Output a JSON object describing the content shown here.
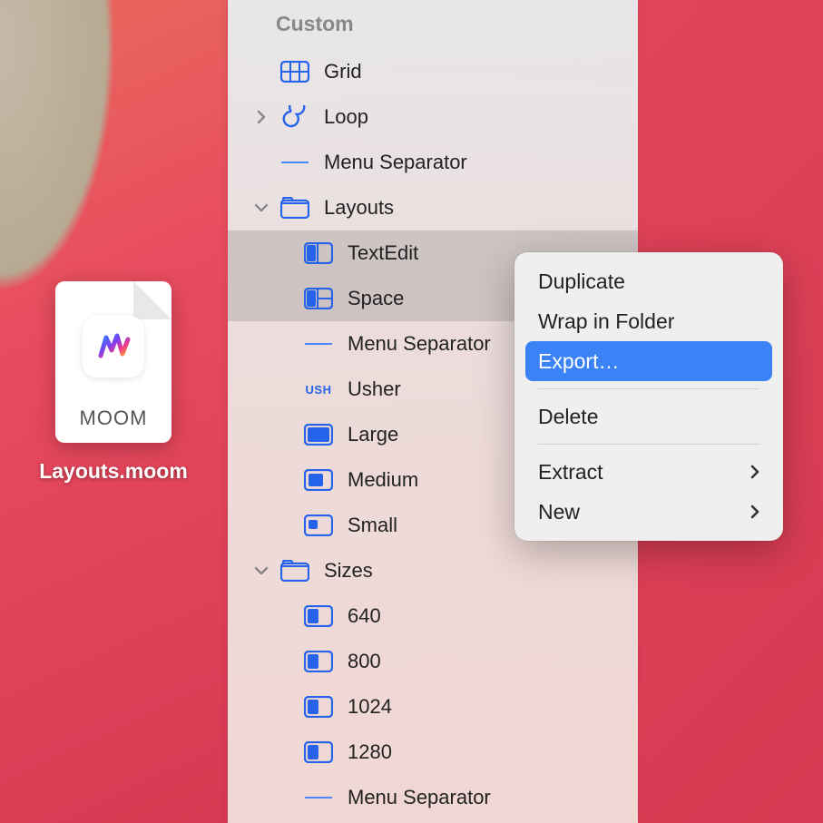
{
  "desktop": {
    "file": {
      "extension": "MOOM",
      "label": "Layouts.moom"
    }
  },
  "panel": {
    "section_header": "Custom",
    "items": [
      {
        "kind": "grid",
        "label": "Grid"
      },
      {
        "kind": "loop",
        "label": "Loop",
        "disclosure": "closed"
      },
      {
        "kind": "separator",
        "label": "Menu Separator"
      },
      {
        "kind": "folder",
        "label": "Layouts",
        "disclosure": "open",
        "children": [
          {
            "kind": "layout",
            "label": "TextEdit",
            "selected": true
          },
          {
            "kind": "layout",
            "label": "Space",
            "selected": true
          },
          {
            "kind": "separator",
            "label": "Menu Separator"
          },
          {
            "kind": "usher",
            "label": "Usher",
            "ush": "USH"
          },
          {
            "kind": "size-lg",
            "label": "Large"
          },
          {
            "kind": "size-md",
            "label": "Medium"
          },
          {
            "kind": "size-sm",
            "label": "Small"
          }
        ]
      },
      {
        "kind": "folder",
        "label": "Sizes",
        "disclosure": "open",
        "children": [
          {
            "kind": "size-half",
            "label": "640"
          },
          {
            "kind": "size-half",
            "label": "800"
          },
          {
            "kind": "size-half",
            "label": "1024"
          },
          {
            "kind": "size-half",
            "label": "1280"
          },
          {
            "kind": "separator",
            "label": "Menu Separator"
          }
        ]
      }
    ]
  },
  "context_menu": {
    "items": [
      {
        "label": "Duplicate"
      },
      {
        "label": "Wrap in Folder"
      },
      {
        "label": "Export…",
        "highlighted": true
      },
      {
        "sep": true
      },
      {
        "label": "Delete"
      },
      {
        "sep": true
      },
      {
        "label": "Extract",
        "submenu": true
      },
      {
        "label": "New",
        "submenu": true
      }
    ]
  },
  "colors": {
    "accent": "#2563eb",
    "icon_stroke": "#2563eb",
    "icon_fill": "#2563eb"
  }
}
